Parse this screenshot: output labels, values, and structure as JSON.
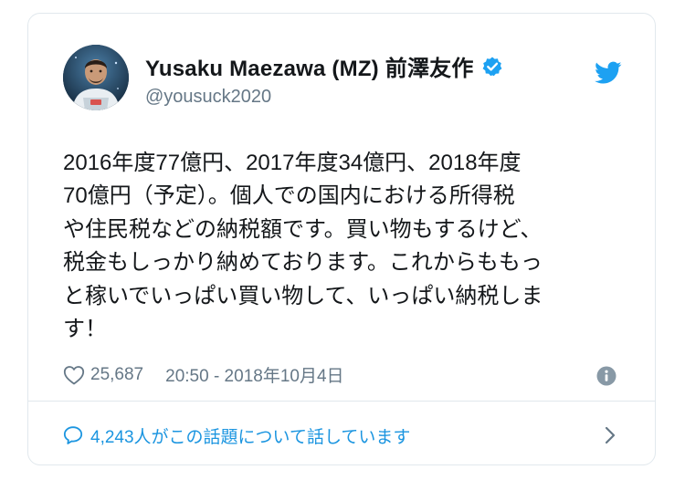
{
  "user": {
    "display_name": "Yusaku Maezawa (MZ) 前澤友作",
    "handle": "@yousuck2020",
    "verified": true
  },
  "tweet": {
    "text": "2016年度77億円、2017年度34億円、2018年度\n70億円（予定）。個人での国内における所得税\nや住民税などの納税額です。買い物もするけど、\n税金もしっかり納めております。これからももっ\nと稼いでいっぱい買い物して、いっぱい納税しま\nす！",
    "likes": "25,687",
    "timestamp": "20:50 - 2018年10月4日"
  },
  "footer": {
    "conversation_label": "4,243人がこの話題について話しています"
  },
  "icons": {
    "verified": "verified-badge-icon",
    "brand": "twitter-bird-icon",
    "like": "heart-icon",
    "info": "info-icon",
    "reply": "speech-bubble-icon",
    "more": "chevron-right-icon"
  },
  "colors": {
    "brand_blue": "#1da1f2",
    "link_blue": "#1b95e0",
    "text_primary": "#14171a",
    "text_secondary": "#657786",
    "border": "#e1e8ed"
  }
}
